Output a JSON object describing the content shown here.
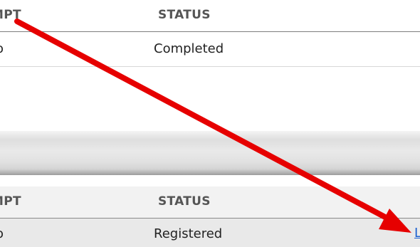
{
  "table_top": {
    "columns": {
      "attempt": "MPT",
      "status": "STATUS"
    },
    "rows": [
      {
        "attempt": "o",
        "status": "Completed"
      }
    ]
  },
  "table_bottom": {
    "columns": {
      "attempt": "MPT",
      "status": "STATUS"
    },
    "rows": [
      {
        "attempt": "o",
        "status": "Registered",
        "action_link": "L"
      }
    ]
  },
  "annotation": {
    "arrow_color": "#e60000",
    "arrow_icon": "red-arrow-icon"
  },
  "colors": {
    "header_text": "#555555",
    "link": "#1a5fd0",
    "row_highlight": "#e9e9e9"
  }
}
